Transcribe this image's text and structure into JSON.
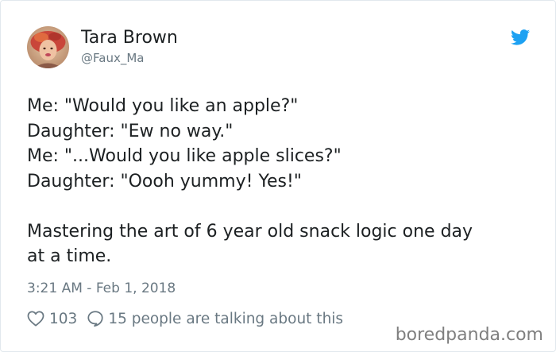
{
  "tweet": {
    "author_name": "Tara Brown",
    "author_handle": "@Faux_Ma",
    "lines": [
      "Me: \"Would you like an apple?\"",
      "Daughter: \"Ew no way.\"",
      "Me: \"...Would you like apple slices?\"",
      "Daughter: \"Oooh yummy! Yes!\"",
      "",
      "Mastering the art of 6 year old snack logic one day",
      "at a time."
    ],
    "timestamp": "3:21 AM - Feb 1, 2018",
    "like_count": "103",
    "reply_text": "15 people are talking about this"
  },
  "icons": {
    "brand": "twitter-bird-icon",
    "like": "heart-icon",
    "reply": "speech-bubble-icon"
  },
  "colors": {
    "twitter_blue": "#1da1f2",
    "text_primary": "#1c2022",
    "text_secondary": "#697882",
    "border": "#e1e8ed",
    "watermark": "#7f7f7f"
  },
  "watermark": "boredpanda.com"
}
